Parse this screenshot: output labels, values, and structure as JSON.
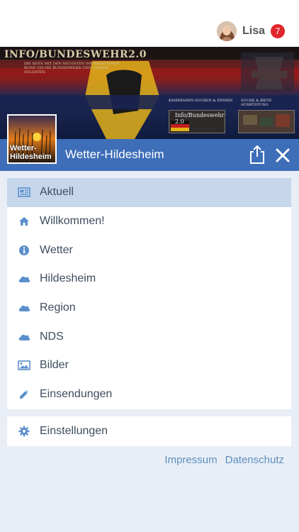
{
  "user": {
    "name": "Lisa",
    "notifications": "7"
  },
  "banner": {
    "title": "INFO/BUNDESWEHR2.0",
    "subtitle": "DIE SEITE MIT DEN NEUESTEN INFORMATIONEN RUND UM DIE BUNDESWEHR UND UNSERE SOLDATEN.",
    "link1": "KAMERADEN SUCHEN & FINDEN",
    "link2": "SUCHE & BIETE AUSRÜSTUNG",
    "thumb_text": "Info/Bundeswehr 2.0"
  },
  "group": {
    "logo_text": "Wetter-Hildesheim",
    "title": "Wetter-Hildesheim"
  },
  "menu": {
    "items": [
      {
        "label": "Aktuell",
        "icon": "news-icon",
        "active": true
      },
      {
        "label": "Willkommen!",
        "icon": "home-icon"
      },
      {
        "label": "Wetter",
        "icon": "info-icon"
      },
      {
        "label": "Hildesheim",
        "icon": "cloud-icon"
      },
      {
        "label": "Region",
        "icon": "cloud-icon"
      },
      {
        "label": "NDS",
        "icon": "cloud-icon"
      },
      {
        "label": "Bilder",
        "icon": "image-icon"
      },
      {
        "label": "Einsendungen",
        "icon": "pencil-icon"
      }
    ],
    "settings": {
      "label": "Einstellungen",
      "icon": "gear-icon"
    }
  },
  "footer": {
    "impressum": "Impressum",
    "datenschutz": "Datenschutz"
  },
  "colors": {
    "header": "#3e6eb8",
    "active_row": "#c6d7ec",
    "icon": "#5b8fcb",
    "badge": "#e0262c",
    "link": "#5c8fbf"
  }
}
